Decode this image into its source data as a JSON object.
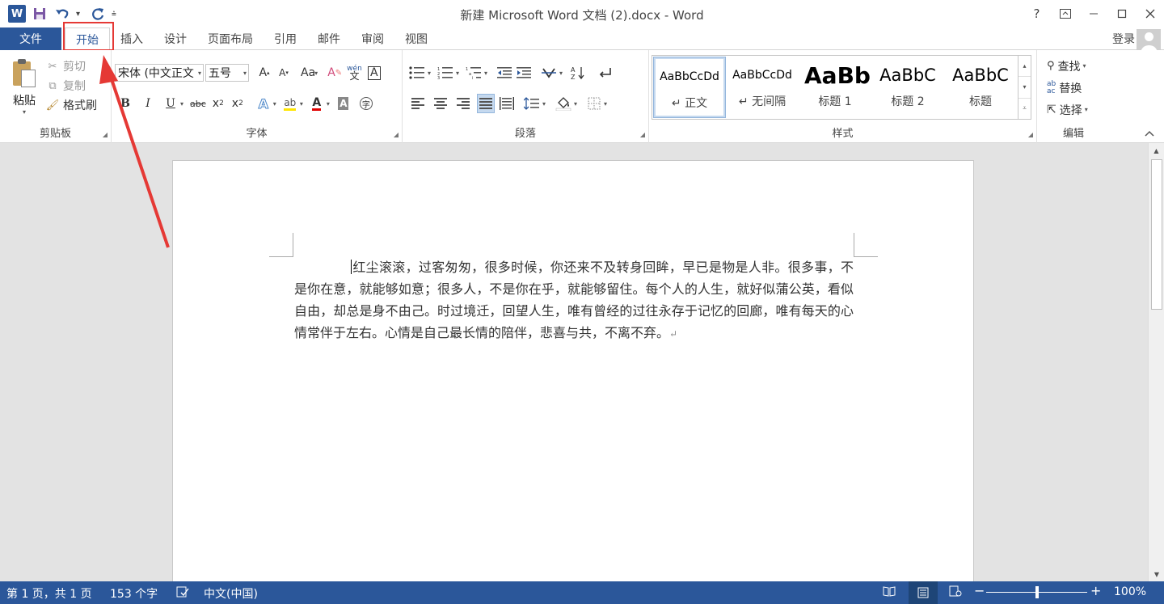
{
  "window": {
    "title": "新建 Microsoft Word 文档 (2).docx - Word",
    "help": "?",
    "controls": {
      "minimize": "—",
      "restore": "❐",
      "close": "✕"
    },
    "ribbon_display_icon": "ribbon-display-icon"
  },
  "qat": {
    "logo": "W",
    "icons": [
      "save-icon",
      "undo-icon",
      "redo-icon",
      "customize-qat-icon"
    ]
  },
  "tabs": {
    "file": "文件",
    "items": [
      "开始",
      "插入",
      "设计",
      "页面布局",
      "引用",
      "邮件",
      "审阅",
      "视图"
    ],
    "active": "开始",
    "login": "登录"
  },
  "clipboard": {
    "paste": "粘贴",
    "cut": "剪切",
    "copy": "复制",
    "format_painter": "格式刷",
    "label": "剪贴板"
  },
  "font": {
    "font_name": "宋体 (中文正文",
    "font_size": "五号",
    "label": "字体",
    "phonetic": "wén",
    "phonetic_char": "文",
    "case": "Aa"
  },
  "paragraph": {
    "label": "段落"
  },
  "styles": {
    "label": "样式",
    "items": [
      {
        "sample": "AaBbCcDd",
        "name": "↵ 正文"
      },
      {
        "sample": "AaBbCcDd",
        "name": "↵ 无间隔"
      },
      {
        "sample": "AaBb",
        "name": "标题 1"
      },
      {
        "sample": "AaBbC",
        "name": "标题 2"
      },
      {
        "sample": "AaBbC",
        "name": "标题"
      }
    ]
  },
  "editing": {
    "label": "编辑",
    "find": "查找",
    "replace": "替换",
    "select": "选择"
  },
  "document": {
    "text": "红尘滚滚，过客匆匆，很多时候，你还来不及转身回眸，早已是物是人非。很多事，不是你在意，就能够如意；很多人，不是你在乎，就能够留住。每个人的人生，就好似蒲公英，看似自由，却总是身不由己。时过境迁，回望人生，唯有曾经的过往永存于记忆的回廊，唯有每天的心情常伴于左右。心情是自己最长情的陪伴，悲喜与共，不离不弃。",
    "paragraph_mark": "↵"
  },
  "status": {
    "page": "第 1 页，共 1 页",
    "words": "153 个字",
    "language": "中文(中国)",
    "zoom": "100%",
    "zoom_level": 1.0
  },
  "colors": {
    "accent": "#2b579a",
    "annotation": "#e53935",
    "font_color": "#e00000",
    "highlight": "#ffe600"
  }
}
